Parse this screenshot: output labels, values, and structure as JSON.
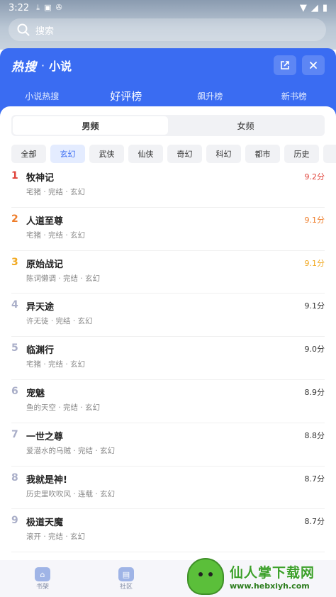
{
  "status_bar": {
    "time": "3:22",
    "icons": [
      "download-icon",
      "app-a-icon",
      "app-game-icon"
    ],
    "right_icons": [
      "wifi-icon",
      "signal-icon",
      "battery-icon"
    ]
  },
  "search": {
    "placeholder": "搜索"
  },
  "panel": {
    "logo": "热搜",
    "separator": "·",
    "title": "小说",
    "tabs": [
      "小说热搜",
      "好评榜",
      "飙升榜",
      "新书榜"
    ],
    "active_tab": "好评榜"
  },
  "gender_tabs": [
    "男频",
    "女频"
  ],
  "active_gender": "男频",
  "categories": [
    "全部",
    "玄幻",
    "武侠",
    "仙侠",
    "奇幻",
    "科幻",
    "都市",
    "历史",
    "军"
  ],
  "active_category": "玄幻",
  "books": [
    {
      "rank": "1",
      "title": "牧神记",
      "meta": "宅猪 · 完结 · 玄幻",
      "score": "9.2分"
    },
    {
      "rank": "2",
      "title": "人道至尊",
      "meta": "宅猪 · 完结 · 玄幻",
      "score": "9.1分"
    },
    {
      "rank": "3",
      "title": "原始战记",
      "meta": "陈词懒调 · 完结 · 玄幻",
      "score": "9.1分"
    },
    {
      "rank": "4",
      "title": "异天途",
      "meta": "许无徒 · 完结 · 玄幻",
      "score": "9.1分"
    },
    {
      "rank": "5",
      "title": "临渊行",
      "meta": "宅猪 · 完结 · 玄幻",
      "score": "9.0分"
    },
    {
      "rank": "6",
      "title": "宠魅",
      "meta": "鱼的天空 · 完结 · 玄幻",
      "score": "8.9分"
    },
    {
      "rank": "7",
      "title": "一世之尊",
      "meta": "爱潜水的乌贼 · 完结 · 玄幻",
      "score": "8.8分"
    },
    {
      "rank": "8",
      "title": "我就是神!",
      "meta": "历史里吹吹风 · 连载 · 玄幻",
      "score": "8.7分"
    },
    {
      "rank": "9",
      "title": "极道天魔",
      "meta": "滚开 · 完结 · 玄幻",
      "score": "8.7分"
    }
  ],
  "bottom_nav": [
    {
      "label": "书架",
      "icon": "bookshelf-icon"
    },
    {
      "label": "社区",
      "icon": "community-icon"
    }
  ],
  "watermark": {
    "main": "仙人掌下载网",
    "url": "www.hebxiyh.com"
  },
  "colors": {
    "accent": "#3a6cf2",
    "rank1": "#e0443b",
    "rank2": "#ee7d2a",
    "rank3": "#f1a820",
    "rank_other": "#a9aec8"
  }
}
